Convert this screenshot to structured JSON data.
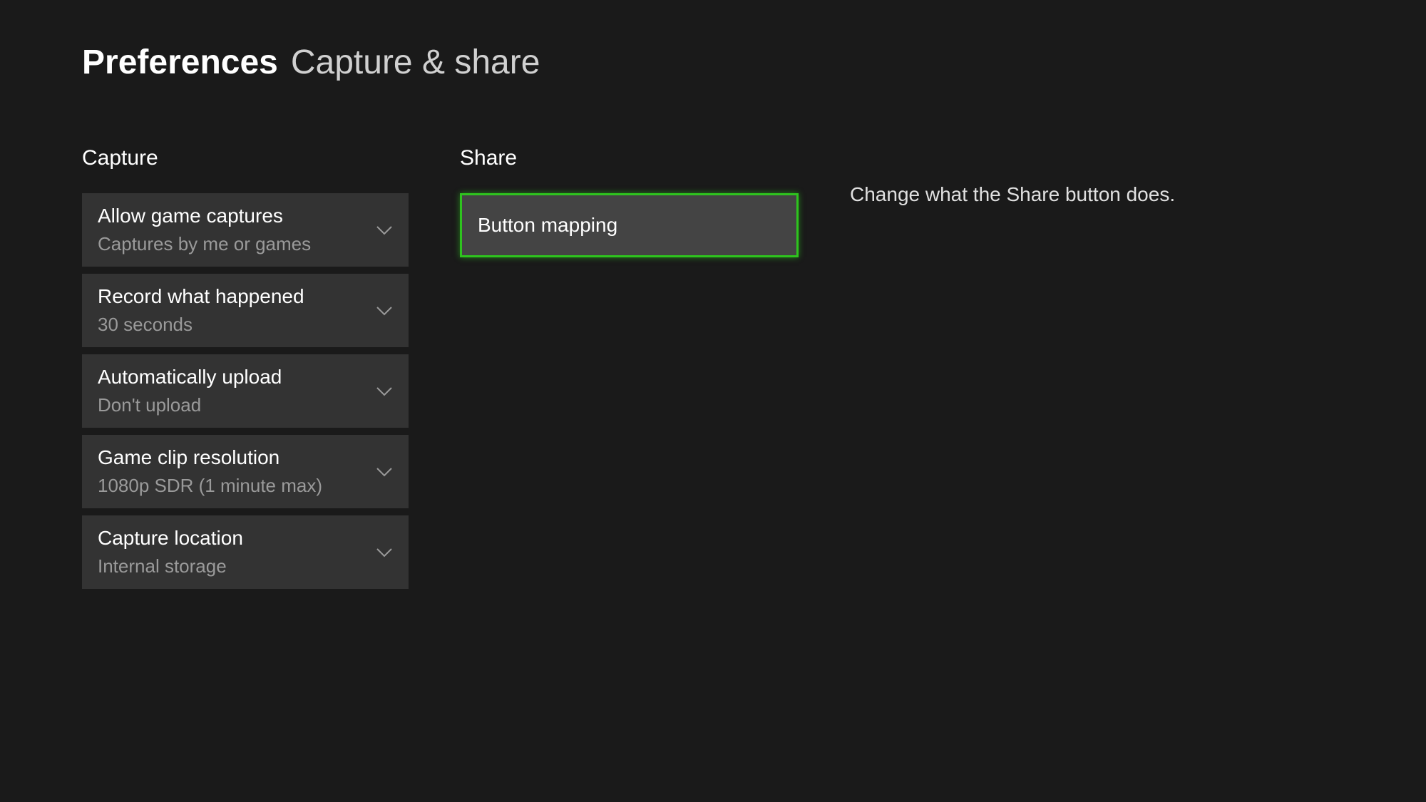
{
  "header": {
    "primary": "Preferences",
    "secondary": "Capture & share"
  },
  "capture": {
    "heading": "Capture",
    "items": [
      {
        "label": "Allow game captures",
        "value": "Captures by me or games"
      },
      {
        "label": "Record what happened",
        "value": "30 seconds"
      },
      {
        "label": "Automatically upload",
        "value": "Don't upload"
      },
      {
        "label": "Game clip resolution",
        "value": "1080p SDR (1 minute max)"
      },
      {
        "label": "Capture location",
        "value": "Internal storage"
      }
    ]
  },
  "share": {
    "heading": "Share",
    "button_label": "Button mapping"
  },
  "description": {
    "text": "Change what the Share button does."
  }
}
